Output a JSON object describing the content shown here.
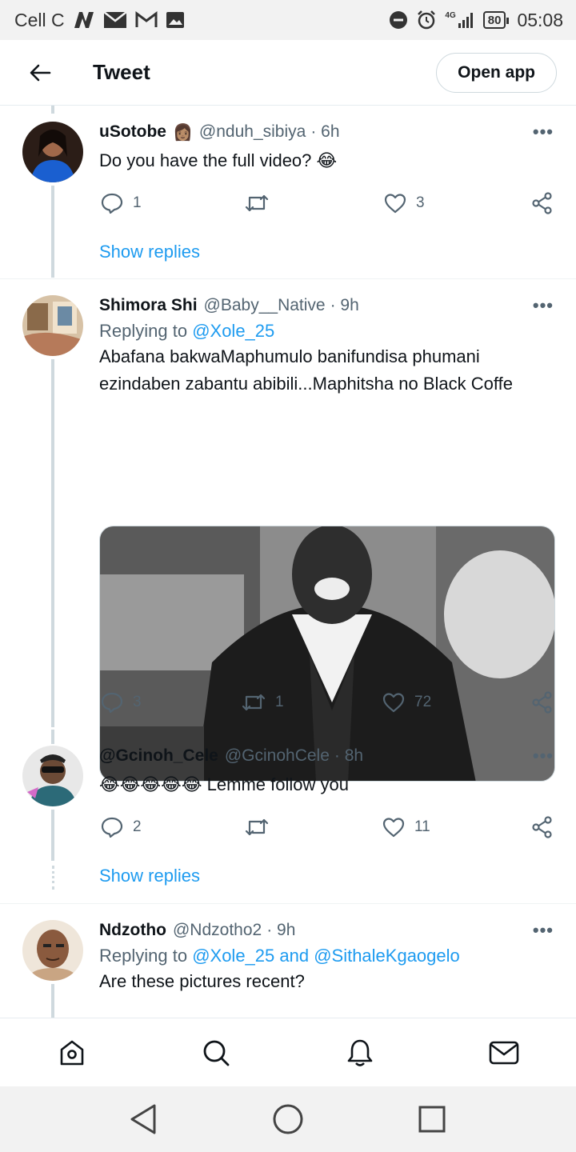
{
  "status_bar": {
    "carrier": "Cell C",
    "network": "4G",
    "battery": "80",
    "time": "05:08"
  },
  "header": {
    "title": "Tweet",
    "open_app_label": "Open app"
  },
  "tweets": [
    {
      "name": "uSotobe",
      "handle": "@nduh_sibiya",
      "time": "· 6h",
      "text": "Do you have the full video? 😂",
      "replies": "1",
      "retweets": "",
      "likes": "3",
      "show_replies": "Show replies",
      "avatar_color": "#1a5fd0"
    },
    {
      "name": "Shimora Shi",
      "handle": "@Baby__Native",
      "time": "· 9h",
      "replying_prefix": "Replying to ",
      "replying_to": "@Xole_25",
      "text": "Abafana bakwaMaphumulo banifundisa phumani ezindaben zabantu abibili...Maphitsha no Black Coffe",
      "replies": "3",
      "retweets": "1",
      "likes": "72",
      "avatar_color": "#8a6a4a"
    },
    {
      "name": "@Gcinoh_Cele",
      "handle": "@GcinohCele",
      "time": "· 8h",
      "text": "😂😂😂😂😂 Lemme follow you",
      "replies": "2",
      "retweets": "",
      "likes": "11",
      "show_replies": "Show replies",
      "avatar_color": "#2c6a78"
    },
    {
      "name": "Ndzotho",
      "handle": "@Ndzotho2",
      "time": "· 9h",
      "replying_prefix": "Replying to ",
      "replying_to": "@Xole_25 and @SithaleKgaogelo",
      "text": "Are these pictures recent?",
      "avatar_color": "#c9a583"
    }
  ],
  "more_glyph": "•••",
  "icons": {
    "back": "arrow-left-icon",
    "reply": "comment-icon",
    "retweet": "retweet-icon",
    "like": "heart-icon",
    "share": "share-icon",
    "home": "home-icon",
    "search": "search-icon",
    "notifications": "bell-icon",
    "messages": "mail-icon"
  },
  "colors": {
    "accent": "#1d9bf0",
    "secondary_text": "#536471"
  }
}
